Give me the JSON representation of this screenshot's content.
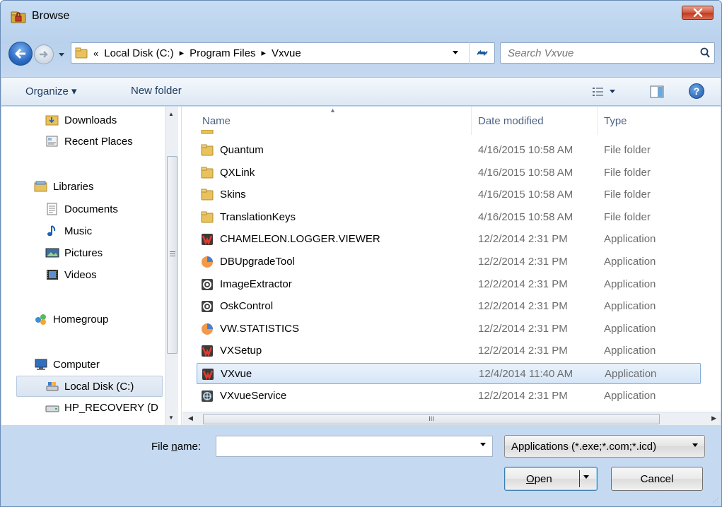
{
  "window": {
    "title": "Browse",
    "icon": "folder-lock-icon"
  },
  "address": {
    "root_chevron": "«",
    "crumbs": [
      "Local Disk (C:)",
      "Program Files",
      "Vxvue"
    ]
  },
  "search": {
    "placeholder": "Search Vxvue"
  },
  "toolbar": {
    "organize": "Organize ▾",
    "new_folder": "New folder"
  },
  "nav": {
    "items": [
      {
        "label": "Downloads",
        "icon": "downloads-folder-icon"
      },
      {
        "label": "Recent Places",
        "icon": "recent-places-icon"
      },
      {
        "label": "Libraries",
        "icon": "libraries-icon"
      },
      {
        "label": "Documents",
        "icon": "documents-icon"
      },
      {
        "label": "Music",
        "icon": "music-icon"
      },
      {
        "label": "Pictures",
        "icon": "pictures-icon"
      },
      {
        "label": "Videos",
        "icon": "videos-icon"
      },
      {
        "label": "Homegroup",
        "icon": "homegroup-icon"
      },
      {
        "label": "Computer",
        "icon": "computer-icon"
      },
      {
        "label": "Local Disk (C:)",
        "icon": "local-disk-icon"
      },
      {
        "label": "HP_RECOVERY (D",
        "icon": "drive-icon"
      }
    ]
  },
  "columns": {
    "name": "Name",
    "date": "Date modified",
    "type": "Type"
  },
  "files": [
    {
      "name": "Quantum",
      "date": "4/16/2015 10:58 AM",
      "type": "File folder",
      "icon": "folder-icon"
    },
    {
      "name": "QXLink",
      "date": "4/16/2015 10:58 AM",
      "type": "File folder",
      "icon": "folder-icon"
    },
    {
      "name": "Skins",
      "date": "4/16/2015 10:58 AM",
      "type": "File folder",
      "icon": "folder-icon"
    },
    {
      "name": "TranslationKeys",
      "date": "4/16/2015 10:58 AM",
      "type": "File folder",
      "icon": "folder-icon"
    },
    {
      "name": "CHAMELEON.LOGGER.VIEWER",
      "date": "12/2/2014 2:31 PM",
      "type": "Application",
      "icon": "vx-app-icon"
    },
    {
      "name": "DBUpgradeTool",
      "date": "12/2/2014 2:31 PM",
      "type": "Application",
      "icon": "orange-app-icon"
    },
    {
      "name": "ImageExtractor",
      "date": "12/2/2014 2:31 PM",
      "type": "Application",
      "icon": "gear-app-icon"
    },
    {
      "name": "OskControl",
      "date": "12/2/2014 2:31 PM",
      "type": "Application",
      "icon": "gear-app-icon"
    },
    {
      "name": "VW.STATISTICS",
      "date": "12/2/2014 2:31 PM",
      "type": "Application",
      "icon": "orange-app-icon"
    },
    {
      "name": "VXSetup",
      "date": "12/2/2014 2:31 PM",
      "type": "Application",
      "icon": "vx-app-icon"
    },
    {
      "name": "VXvue",
      "date": "12/4/2014 11:40 AM",
      "type": "Application",
      "icon": "vx-app-icon",
      "selected": true
    },
    {
      "name": "VXvueService",
      "date": "12/2/2014 2:31 PM",
      "type": "Application",
      "icon": "service-app-icon"
    }
  ],
  "hscroll_grip": "III",
  "bottom": {
    "filename_label": "File name:",
    "filename_value": "",
    "filter": "Applications (*.exe;*.com;*.icd)",
    "open": "Open",
    "cancel": "Cancel"
  }
}
